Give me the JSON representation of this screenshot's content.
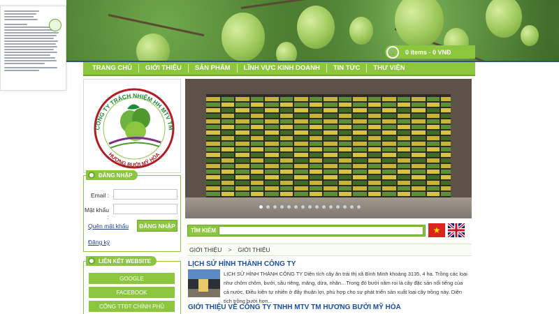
{
  "cart": {
    "text": "0 items - 0 VNĐ",
    "icon": "cart-icon"
  },
  "nav": {
    "items": [
      "TRANG CHỦ",
      "GIỚI THIỆU",
      "SẢN PHẨM",
      "LĨNH VỰC KINH DOANH",
      "TIN TỨC",
      "THƯ VIỆN"
    ]
  },
  "logo": {
    "company_top": "CÔNG TY TRÁCH NHIỆM HH MTV TM",
    "company_bottom": "HƯƠNG BƯỞI MỸ HÒA"
  },
  "search": {
    "label": "TÌM KIẾM",
    "placeholder": ""
  },
  "login": {
    "heading": "ĐĂNG NHẬP",
    "email_label": "Email :",
    "password_label": "Mật khẩu :",
    "forgot_link": "Quên mật khẩu",
    "submit_label": "ĐĂNG NHẬP",
    "register_link": "Đăng ký"
  },
  "links": {
    "heading": "LIÊN KẾT WEBSITE",
    "items": [
      "GOOGLE",
      "FACEBOOK",
      "CỔNG TTĐT CHÍNH PHỦ"
    ]
  },
  "breadcrumb": {
    "items": [
      "GIỚI THIỆU",
      "GIỚI THIỆU"
    ],
    "separator": ">"
  },
  "articles": [
    {
      "title": "LỊCH SỬ HÌNH THÀNH CÔNG TY",
      "excerpt": "LỊCH SỬ HÌNH THÀNH CÔNG TY Diện tích cây ăn trái thị xã Bình Minh khoảng 3135, 4  ha. Trồng các loại như chôm chôm, bưởi, sầu riêng, măng, dừa, nhãn…Trong đó bưởi năm roi là cây đặc sản nổi tiếng của cả nước. Điều kiện tự nhiên ở đây thuận lợi, phù hợp cho sự phát triển sản xuất loại cây trồng này. Diện tích trồng bưởi hơn..."
    },
    {
      "title": "GIỚI THIỆU VỀ CÔNG TY TNHH MTV TM HƯƠNG BƯỞI MỸ HÒA"
    }
  ],
  "slider": {
    "total_slides": 15,
    "active_slide": 1
  },
  "colors": {
    "brand_green": "#8cc63f",
    "link_blue": "#1a4fa0",
    "flag_red": "#da251d"
  }
}
